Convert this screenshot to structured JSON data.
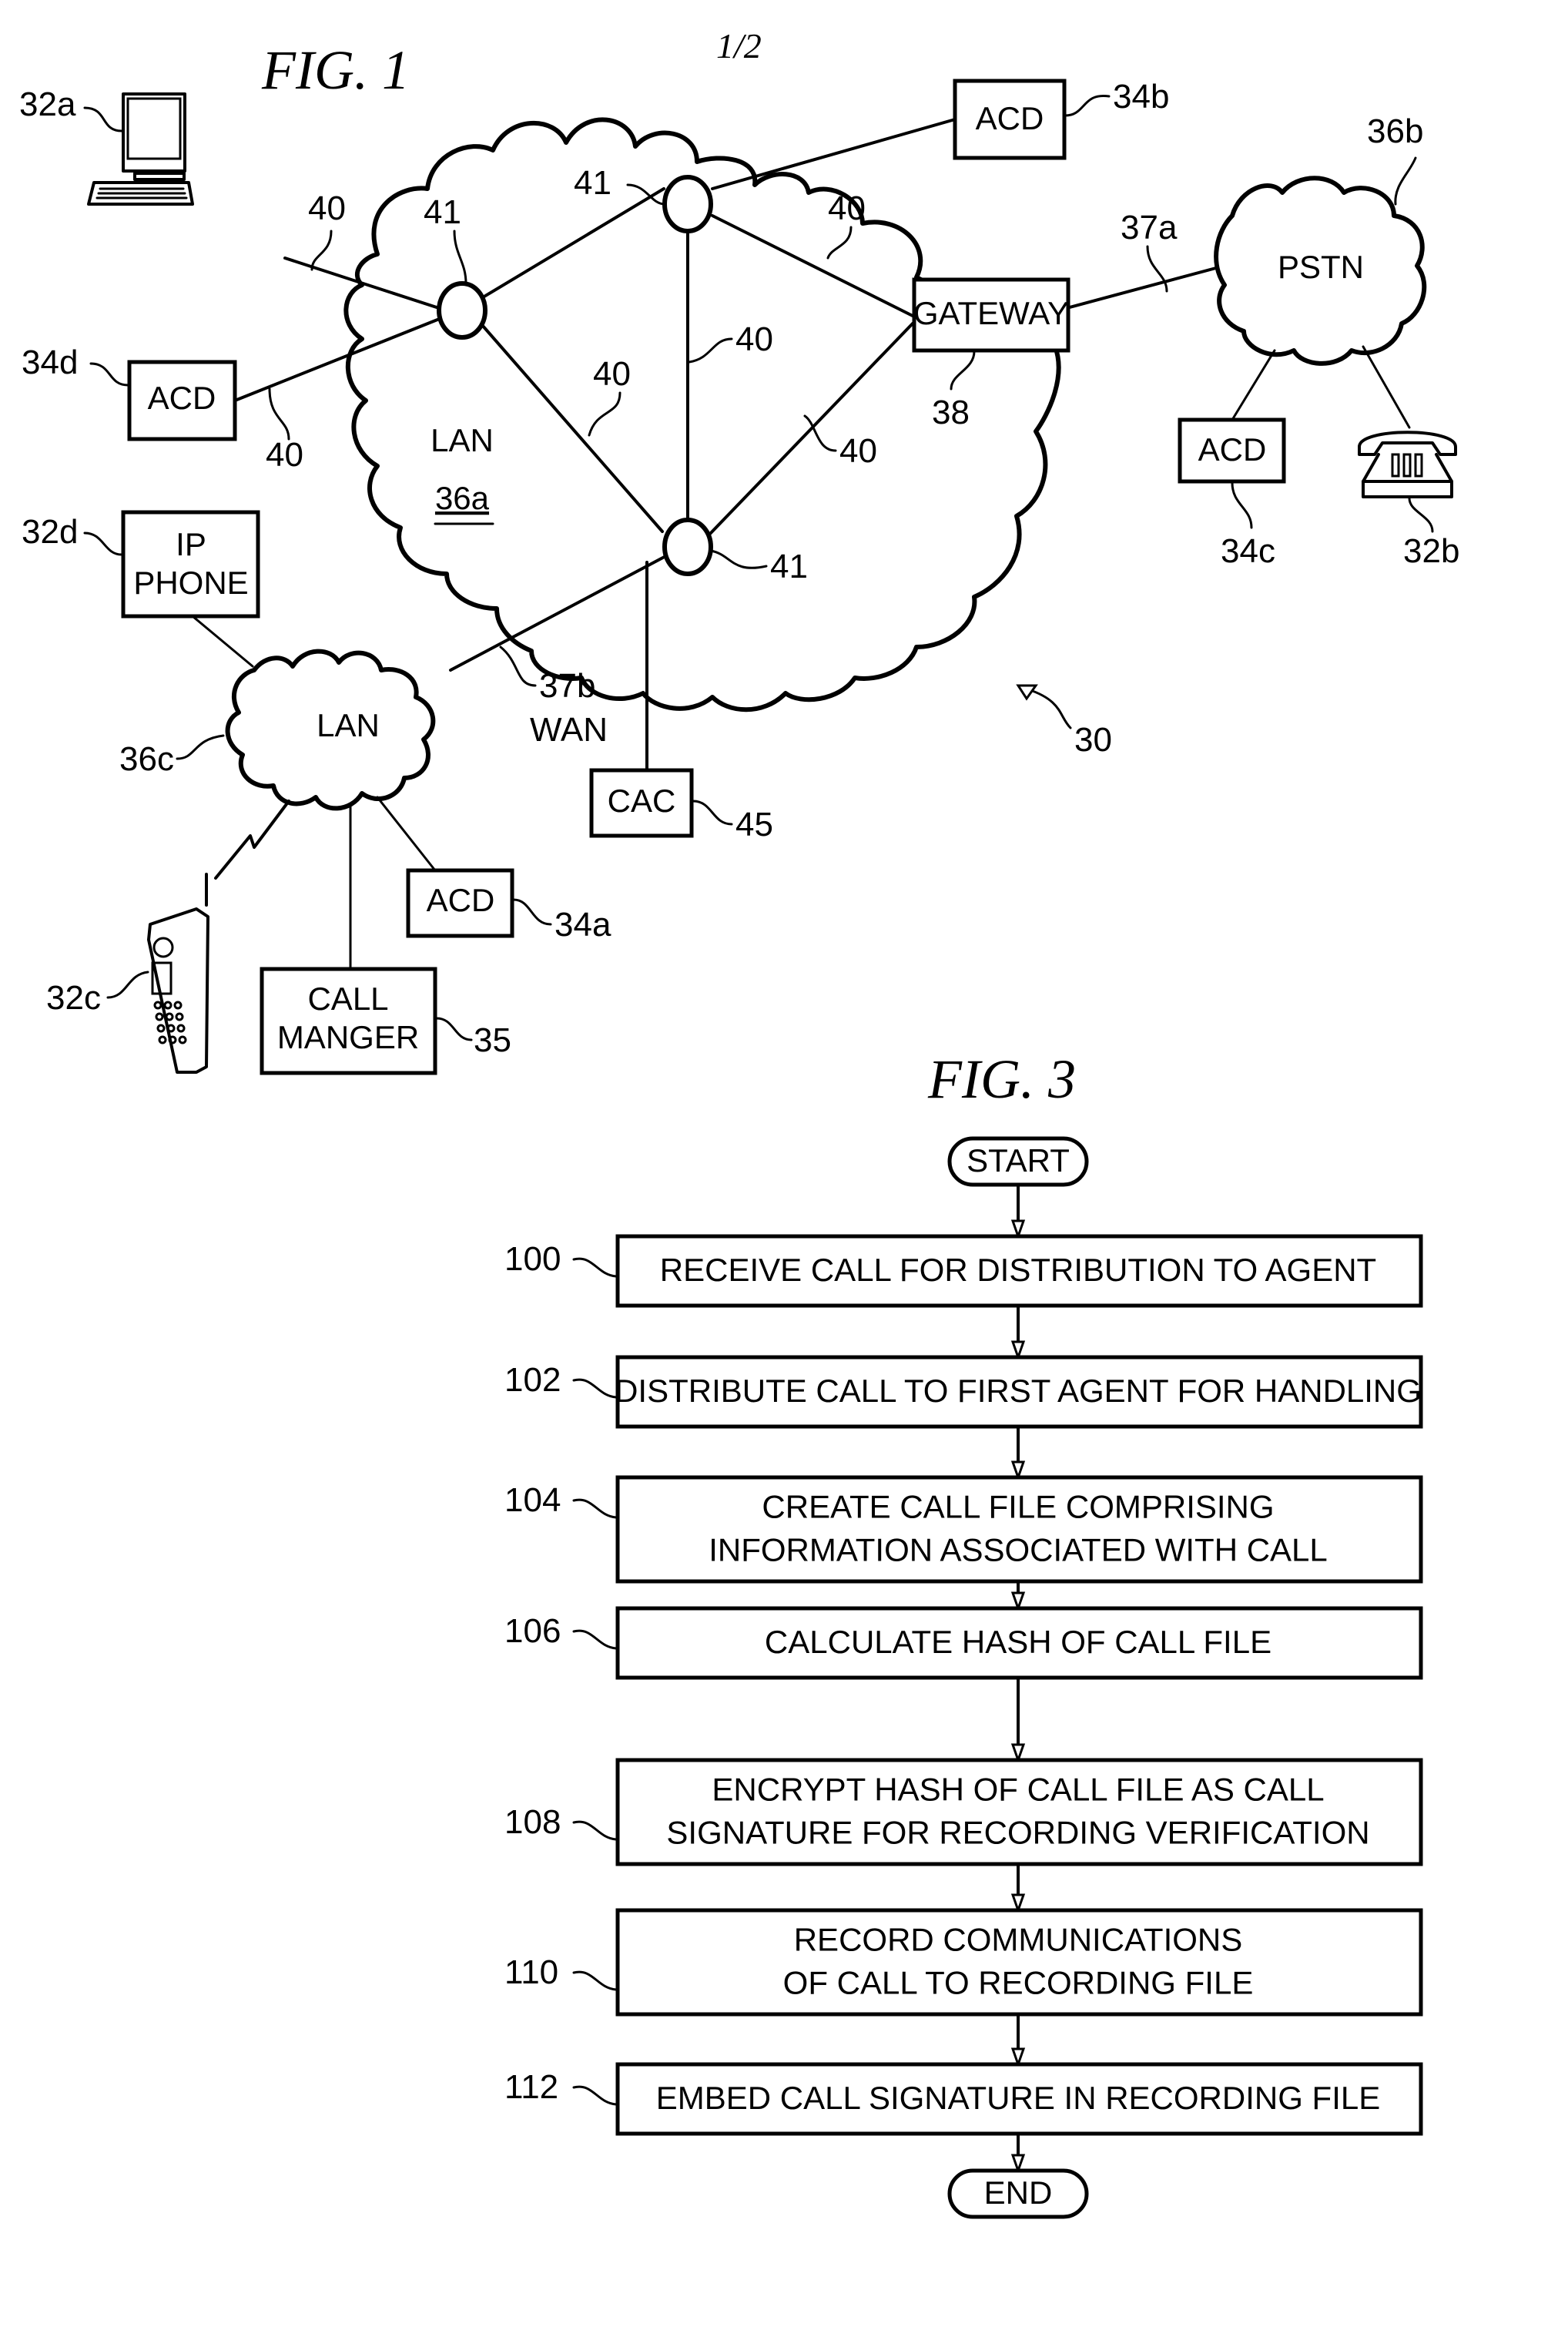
{
  "sheet_number": "1/2",
  "fig1": {
    "title": "FIG. 1",
    "system_ref": "30",
    "networks": {
      "lan_36a": {
        "label": "LAN",
        "ref": "36a"
      },
      "pstn_36b": {
        "label": "PSTN",
        "ref": "36b"
      },
      "lan_36c": {
        "label": "LAN",
        "ref": "36c"
      }
    },
    "nodes": {
      "ref": "41"
    },
    "links": {
      "ref": "40",
      "link_37a": "37a",
      "link_37b": "37b",
      "wan_label": "WAN"
    },
    "devices": {
      "computer_32a": {
        "ref": "32a"
      },
      "phone_32b": {
        "ref": "32b"
      },
      "cellphone_32c": {
        "ref": "32c"
      },
      "ip_phone_32d": {
        "line1": "IP",
        "line2": "PHONE",
        "ref": "32d"
      },
      "acd_34a": {
        "label": "ACD",
        "ref": "34a"
      },
      "acd_34b": {
        "label": "ACD",
        "ref": "34b"
      },
      "acd_34c": {
        "label": "ACD",
        "ref": "34c"
      },
      "acd_34d": {
        "label": "ACD",
        "ref": "34d"
      },
      "call_manager_35": {
        "line1": "CALL",
        "line2": "MANGER",
        "ref": "35"
      },
      "gateway_38": {
        "label": "GATEWAY",
        "ref": "38"
      },
      "cac_45": {
        "label": "CAC",
        "ref": "45"
      }
    }
  },
  "fig3": {
    "title": "FIG. 3",
    "start": "START",
    "end": "END",
    "steps": [
      {
        "ref": "100",
        "lines": [
          "RECEIVE CALL FOR DISTRIBUTION TO AGENT"
        ]
      },
      {
        "ref": "102",
        "lines": [
          "DISTRIBUTE CALL TO FIRST AGENT FOR HANDLING"
        ]
      },
      {
        "ref": "104",
        "lines": [
          "CREATE CALL FILE COMPRISING",
          "INFORMATION ASSOCIATED WITH CALL"
        ]
      },
      {
        "ref": "106",
        "lines": [
          "CALCULATE HASH OF CALL FILE"
        ]
      },
      {
        "ref": "108",
        "lines": [
          "ENCRYPT HASH OF CALL FILE AS CALL",
          "SIGNATURE FOR RECORDING VERIFICATION"
        ]
      },
      {
        "ref": "110",
        "lines": [
          "RECORD COMMUNICATIONS",
          "OF CALL TO RECORDING FILE"
        ]
      },
      {
        "ref": "112",
        "lines": [
          "EMBED CALL SIGNATURE IN RECORDING FILE"
        ]
      }
    ]
  }
}
